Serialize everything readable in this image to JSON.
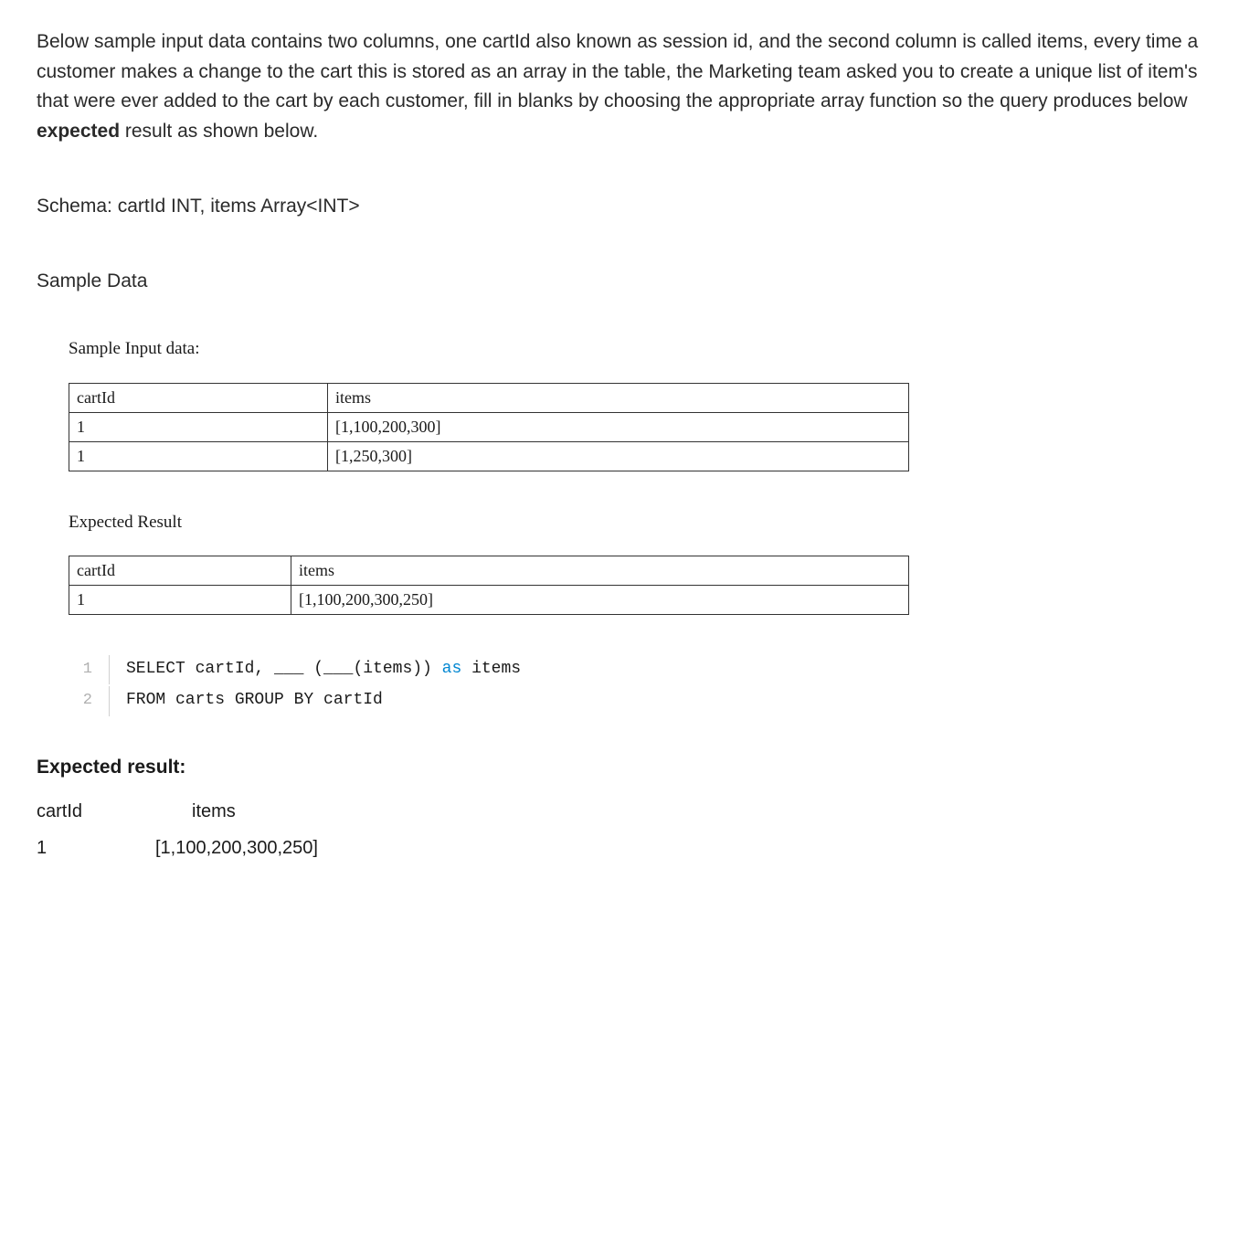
{
  "intro": {
    "text_before_bold": "Below sample input data contains two columns, one cartId also known as session id, and the second column is called items, every time a customer makes a change to the cart this is stored as an array in the table, the Marketing team asked you to create a unique list of item's that were ever added to the cart by each customer, fill in blanks by choosing the appropriate array function so the query produces below ",
    "bold_word": "expected",
    "text_after_bold": " result as shown below."
  },
  "schema": "Schema: cartId INT, items Array<INT>",
  "sample_data_label": "Sample Data",
  "sample_input_label": "Sample Input data:",
  "sample_table": {
    "headers": [
      "cartId",
      "items"
    ],
    "rows": [
      [
        "1",
        "[1,100,200,300]"
      ],
      [
        "1",
        "[1,250,300]"
      ]
    ]
  },
  "expected_result_label": "Expected Result",
  "expected_table": {
    "headers": [
      "cartId",
      "items"
    ],
    "rows": [
      [
        "1",
        "[1,100,200,300,250]"
      ]
    ]
  },
  "code": {
    "line1": {
      "number": "1",
      "part1": "SELECT cartId, ___ (___(items)) ",
      "as": "as",
      "part2": " items"
    },
    "line2": {
      "number": "2",
      "text": "FROM carts GROUP BY cartId"
    }
  },
  "bottom_expected_label": "Expected result:",
  "bottom_result": {
    "headers": [
      "cartId",
      "items"
    ],
    "row": [
      "1",
      "[1,100,200,300,250]"
    ]
  }
}
